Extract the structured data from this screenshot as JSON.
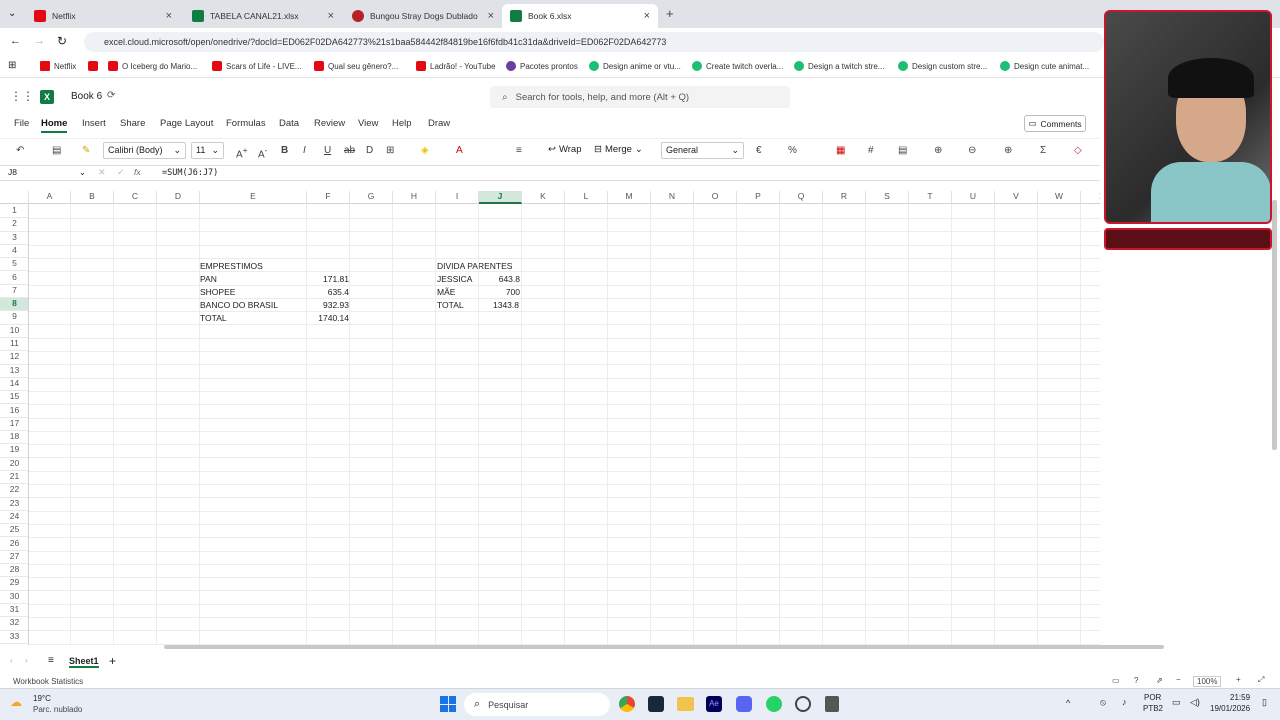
{
  "browser": {
    "tabs": [
      {
        "label": "Netflix",
        "color": "#e50914"
      },
      {
        "label": "TABELA CANAL21.xlsx",
        "color": "#107c41"
      },
      {
        "label": "Bungou Stray Dogs Dublado Ep",
        "color": "#b4232a"
      },
      {
        "label": "Book 6.xlsx",
        "color": "#107c41"
      }
    ],
    "url": "excel.cloud.microsoft/open/onedrive/?docId=ED062F02DA642773%21s1baa584442f84819be16f6fdb41c31da&driveId=ED062F02DA642773",
    "bookmarks": [
      {
        "label": "Netflix",
        "color": "#e50914"
      },
      {
        "label": "",
        "color": "#e50914"
      },
      {
        "label": "O Iceberg do Mario...",
        "color": "#e50914"
      },
      {
        "label": "Scars of Life - LIVE...",
        "color": "#e50914"
      },
      {
        "label": "Qual seu gênero?...",
        "color": "#e50914"
      },
      {
        "label": "Ladrão! - YouTube",
        "color": "#e50914"
      },
      {
        "label": "Pacotes prontos",
        "color": "#6b3fa0"
      },
      {
        "label": "Design anime or vtu...",
        "color": "#1dbf73"
      },
      {
        "label": "Create twitch overla...",
        "color": "#1dbf73"
      },
      {
        "label": "Design a twitch stre...",
        "color": "#1dbf73"
      },
      {
        "label": "Design custom stre...",
        "color": "#1dbf73"
      },
      {
        "label": "Design cute animat...",
        "color": "#1dbf73"
      }
    ]
  },
  "excel": {
    "title": "Book 6",
    "search_placeholder": "Search for tools, help, and more (Alt + Q)",
    "menu": [
      "File",
      "Home",
      "Insert",
      "Share",
      "Page Layout",
      "Formulas",
      "Data",
      "Review",
      "View",
      "Help",
      "Draw"
    ],
    "comments_label": "Comments",
    "font": "Calibri (Body)",
    "font_size": "11",
    "wrap_label": "Wrap",
    "merge_label": "Merge",
    "number_format": "General",
    "name_box": "J8",
    "formula": "=SUM(J6:J7)",
    "columns": [
      "A",
      "B",
      "C",
      "D",
      "E",
      "F",
      "G",
      "H",
      "I",
      "J",
      "K",
      "L",
      "M",
      "N",
      "O",
      "P",
      "Q",
      "R",
      "S",
      "T",
      "U",
      "V",
      "W",
      "X"
    ],
    "rows": [
      "1",
      "2",
      "3",
      "4",
      "5",
      "6",
      "7",
      "8",
      "9",
      "10",
      "11",
      "12",
      "13",
      "14",
      "15",
      "16",
      "17",
      "18",
      "19",
      "20",
      "21",
      "22",
      "23",
      "24",
      "25",
      "26",
      "27",
      "28",
      "29",
      "30",
      "31",
      "32",
      "33"
    ],
    "cells": {
      "e5": "EMPRESTIMOS",
      "e6": "PAN",
      "f6": "171.81",
      "e7": "SHOPEE",
      "f7": "635.4",
      "e8": "BANCO DO BRASIL",
      "f8": "932.93",
      "e9": "TOTAL",
      "f9": "1740.14",
      "i5": "DIVIDA PARENTES",
      "i6": "JESSICA",
      "j6": "643.8",
      "i7": "MÃE",
      "j7": "700",
      "i8": "TOTAL",
      "j8": "1343.8"
    },
    "sheet_tab": "Sheet1",
    "status": "Workbook Statistics",
    "zoom": "100%"
  },
  "taskbar": {
    "weather_temp": "19°C",
    "weather_desc": "Parc. nublado",
    "search_label": "Pesquisar",
    "lang1": "POR",
    "lang2": "PTB2",
    "time": "21:59",
    "date": "19/01/2026"
  },
  "colors": {
    "accent": "#107c41",
    "selection": "#217346"
  }
}
